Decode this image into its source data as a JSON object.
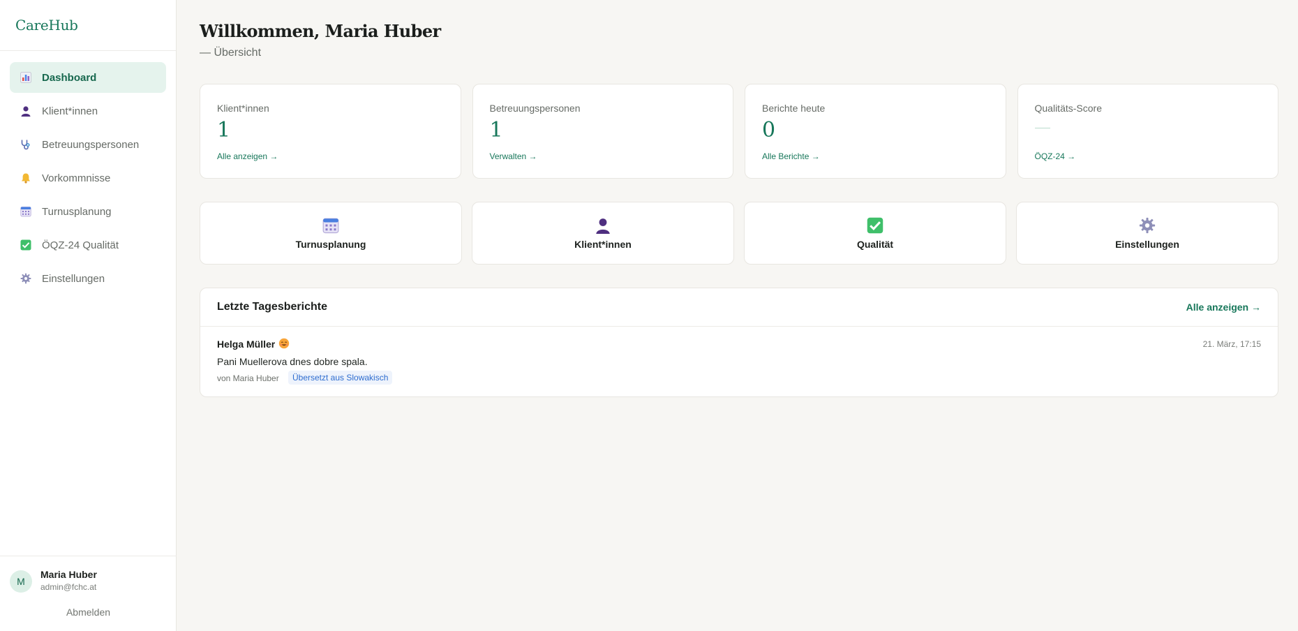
{
  "app": {
    "brand": "CareHub"
  },
  "sidebar": {
    "items": [
      {
        "label": "Dashboard",
        "icon": "bar-chart-icon",
        "active": true
      },
      {
        "label": "Klient*innen",
        "icon": "person-icon"
      },
      {
        "label": "Betreuungspersonen",
        "icon": "stethoscope-icon"
      },
      {
        "label": "Vorkommnisse",
        "icon": "bell-icon"
      },
      {
        "label": "Turnusplanung",
        "icon": "calendar-icon"
      },
      {
        "label": "ÖQZ-24 Qualität",
        "icon": "checkbox-icon"
      },
      {
        "label": "Einstellungen",
        "icon": "gear-icon"
      }
    ],
    "user": {
      "initial": "M",
      "name": "Maria Huber",
      "email": "admin@fchc.at",
      "logout": "Abmelden"
    }
  },
  "header": {
    "title": "Willkommen, Maria Huber",
    "subtitle": "— Übersicht"
  },
  "stats": [
    {
      "label": "Klient*innen",
      "value": "1",
      "link": "Alle anzeigen →"
    },
    {
      "label": "Betreuungspersonen",
      "value": "1",
      "link": "Verwalten →"
    },
    {
      "label": "Berichte heute",
      "value": "0",
      "link": "Alle Berichte →"
    },
    {
      "label": "Qualitäts-Score",
      "value": "",
      "link": "ÖQZ-24 →"
    }
  ],
  "quick_links": [
    {
      "label": "Turnusplanung",
      "icon": "calendar-icon"
    },
    {
      "label": "Klient*innen",
      "icon": "person-icon"
    },
    {
      "label": "Qualität",
      "icon": "checkbox-icon"
    },
    {
      "label": "Einstellungen",
      "icon": "gear-icon"
    }
  ],
  "reports": {
    "title": "Letzte Tagesberichte",
    "view_all": "Alle anzeigen →",
    "items": [
      {
        "client": "Helga Müller",
        "mood_icon": "smiling-face-icon",
        "time": "21. März, 17:15",
        "text": "Pani Muellerova dnes dobre spala.",
        "author": "von Maria Huber",
        "badge": "Übersetzt aus Slowakisch"
      }
    ]
  },
  "colors": {
    "accent": "#17775a",
    "active_bg": "#e5f3ed",
    "background": "#f7f6f3",
    "badge": "#2d6ccf"
  }
}
